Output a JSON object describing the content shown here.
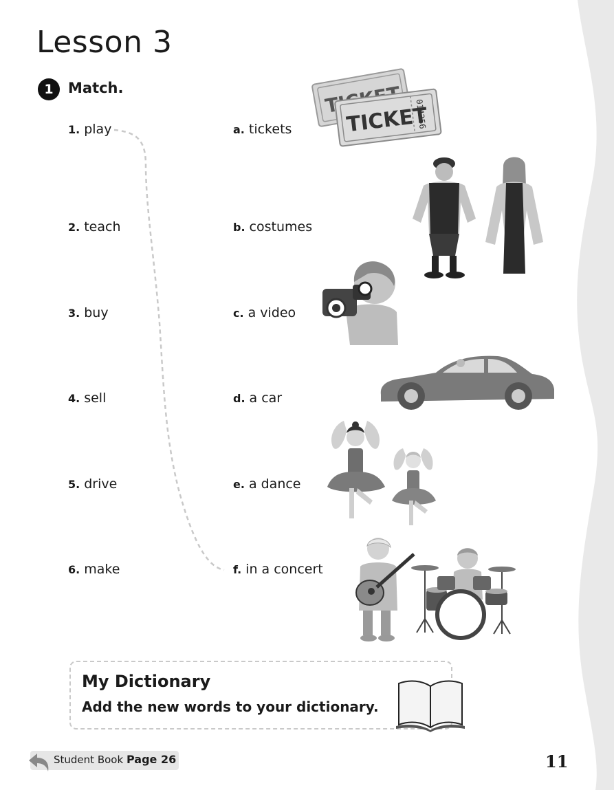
{
  "lesson_title": "Lesson 3",
  "exercise": {
    "number": "1",
    "instruction": "Match."
  },
  "verbs": [
    {
      "num": "1.",
      "word": "play"
    },
    {
      "num": "2.",
      "word": "teach"
    },
    {
      "num": "3.",
      "word": "buy"
    },
    {
      "num": "4.",
      "word": "sell"
    },
    {
      "num": "5.",
      "word": "drive"
    },
    {
      "num": "6.",
      "word": "make"
    }
  ],
  "nouns": [
    {
      "letter": "a.",
      "phrase": "tickets"
    },
    {
      "letter": "b.",
      "phrase": "costumes"
    },
    {
      "letter": "c.",
      "phrase": "a video"
    },
    {
      "letter": "d.",
      "phrase": "a car"
    },
    {
      "letter": "e.",
      "phrase": "a dance"
    },
    {
      "letter": "f.",
      "phrase": "in a concert"
    }
  ],
  "ticket": {
    "text": "TICKET",
    "serial": "014256"
  },
  "dictionary": {
    "title": "My Dictionary",
    "text": "Add the new words to your dictionary."
  },
  "footer": {
    "student_book": "Student Book",
    "page_ref": "Page 26",
    "page_number": "11"
  },
  "colors": {
    "edge": "#e9e9e9",
    "ink": "#1a1a1a",
    "dash": "#c9c9c9"
  }
}
